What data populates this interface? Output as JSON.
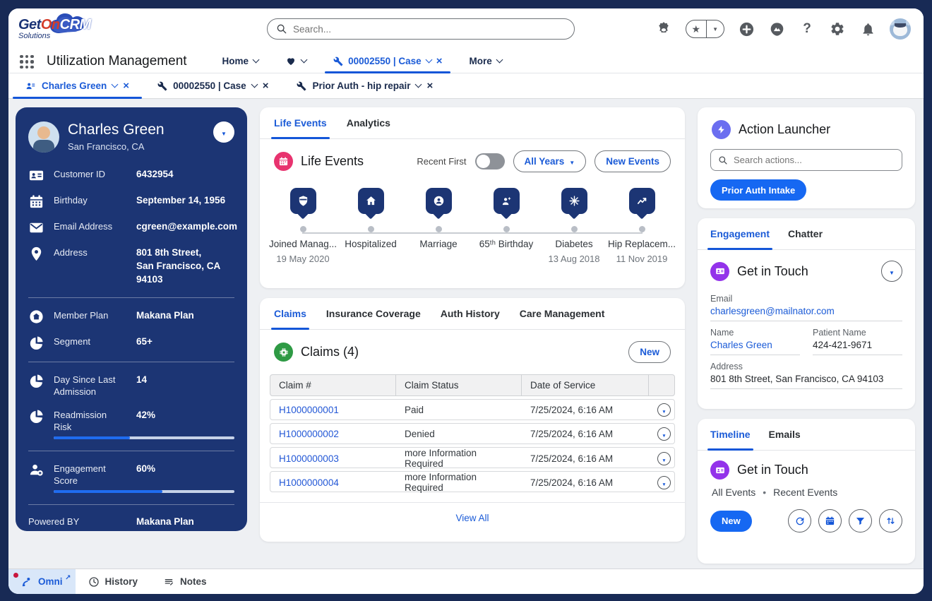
{
  "colors": {
    "accent": "#1b5bd7",
    "navy": "#1c3574",
    "button_blue": "#1668f2",
    "pink": "#e8336f",
    "green": "#2e9a44",
    "indigo": "#6b6ef0",
    "purple": "#9333ea",
    "frame": "#182a55"
  },
  "header": {
    "logo": {
      "get": "Get",
      "on": "On",
      "crm": "CRM",
      "solutions": "Solutions"
    },
    "search_placeholder": "Search...",
    "icons": [
      "einstein",
      "favorites",
      "add",
      "trailhead",
      "help",
      "setup",
      "notifications",
      "profile-avatar"
    ]
  },
  "nav": {
    "app_title": "Utilization Management",
    "tabs": [
      {
        "label": "Home"
      },
      {
        "label": ""
      },
      {
        "label": "00002550 | Case"
      },
      {
        "label": "More"
      }
    ]
  },
  "subtabs": [
    {
      "label": "Charles Green"
    },
    {
      "label": "00002550 | Case"
    },
    {
      "label": "Prior Auth - hip repair"
    }
  ],
  "profile": {
    "name": "Charles Green",
    "location": "San Francisco, CA",
    "fields": [
      {
        "label": "Customer ID",
        "value": "6432954"
      },
      {
        "label": "Birthday",
        "value": "September 14, 1956"
      },
      {
        "label": "Email Address",
        "value": "cgreen@example.com"
      },
      {
        "label": "Address",
        "value": "801 8th Street,\nSan Francisco, CA\n94103"
      }
    ],
    "plan": [
      {
        "label": "Member Plan",
        "value": "Makana Plan"
      },
      {
        "label": "Segment",
        "value": "65+"
      }
    ],
    "metrics": [
      {
        "label": "Day Since Last Admission",
        "value": "14"
      },
      {
        "label": "Readmission Risk",
        "value": "42%",
        "progress": 42
      },
      {
        "label": "Engagement Score",
        "value": "60%",
        "progress": 60
      }
    ],
    "powered_by_label": "Powered BY",
    "powered_by_value": "Makana Plan"
  },
  "life_events_card": {
    "tabs": {
      "life_events": "Life Events",
      "analytics": "Analytics"
    },
    "title": "Life Events",
    "toggle_label": "Recent First",
    "year_filter_label": "All Years",
    "new_button": "New Events",
    "events": [
      {
        "name": "Joined Manag...",
        "date": "19 May 2020"
      },
      {
        "name": "Hospitalized",
        "date": ""
      },
      {
        "name": "Marriage",
        "date": ""
      },
      {
        "name": "65ᵗʰ Birthday",
        "date": ""
      },
      {
        "name": "Diabetes",
        "date": "13 Aug 2018"
      },
      {
        "name": "Hip Replacem...",
        "date": "11 Nov 2019"
      }
    ]
  },
  "claims_card": {
    "tabs": {
      "claims": "Claims",
      "insurance": "Insurance Coverage",
      "auth": "Auth History",
      "care": "Care Management"
    },
    "title": "Claims (4)",
    "new_button": "New",
    "headers": {
      "claim": "Claim #",
      "status": "Claim Status",
      "date": "Date of Service"
    },
    "rows": [
      {
        "claim": "H1000000001",
        "status": "Paid",
        "date": "7/25/2024, 6:16 AM"
      },
      {
        "claim": "H1000000002",
        "status": "Denied",
        "date": "7/25/2024, 6:16 AM"
      },
      {
        "claim": "H1000000003",
        "status": "more Information Required",
        "date": "7/25/2024, 6:16 AM"
      },
      {
        "claim": "H1000000004",
        "status": "more Information Required",
        "date": "7/25/2024, 6:16 AM"
      }
    ],
    "view_all": "View All"
  },
  "action_launcher": {
    "title": "Action Launcher",
    "search_placeholder": "Search actions...",
    "button": "Prior Auth Intake"
  },
  "engagement_card": {
    "tabs": {
      "engagement": "Engagement",
      "chatter": "Chatter"
    },
    "title": "Get in Touch",
    "email_label": "Email",
    "email": "charlesgreen@mailnator.com",
    "name_label": "Name",
    "name": "Charles Green",
    "patient_label": "Patient Name",
    "patient": "424-421-9671",
    "address_label": "Address",
    "address": "801 8th Street, San Francisco, CA 94103"
  },
  "timeline_card": {
    "tabs": {
      "timeline": "Timeline",
      "emails": "Emails"
    },
    "title": "Get in Touch",
    "filters": {
      "all": "All Events",
      "recent": "Recent Events"
    },
    "new_button": "New"
  },
  "utility_bar": {
    "omni": "Omni",
    "history": "History",
    "notes": "Notes"
  }
}
